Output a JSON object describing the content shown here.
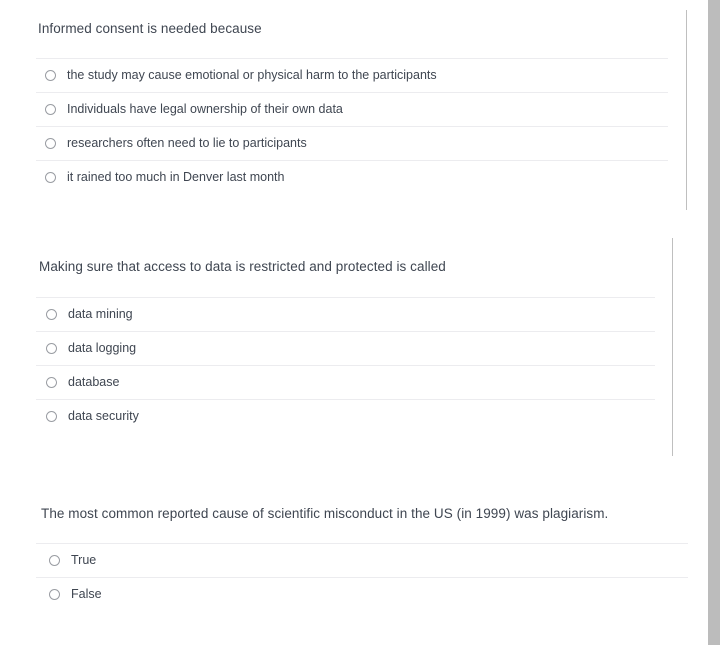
{
  "questions": [
    {
      "id": "informed-consent",
      "prompt": "Informed consent is needed because",
      "options": [
        "the study may cause emotional or physical harm to the participants",
        "Individuals have legal ownership of their own data",
        "researchers often need to lie to participants",
        "it rained too much in Denver last month"
      ]
    },
    {
      "id": "data-security",
      "prompt": "Making sure that access to data is restricted and protected is called",
      "options": [
        "data mining",
        "data logging",
        "database",
        "data security"
      ]
    },
    {
      "id": "scientific-misconduct",
      "prompt": "The most common reported cause of scientific misconduct in the US (in 1999) was plagiarism.",
      "options": [
        "True",
        "False"
      ]
    }
  ],
  "colors": {
    "text": "#3f4651",
    "separator": "#ececef",
    "radio_border": "#9a9da3",
    "scrollbar": "#bcbcbc",
    "edge_rule": "#bfbfbf",
    "background": "#ffffff"
  }
}
